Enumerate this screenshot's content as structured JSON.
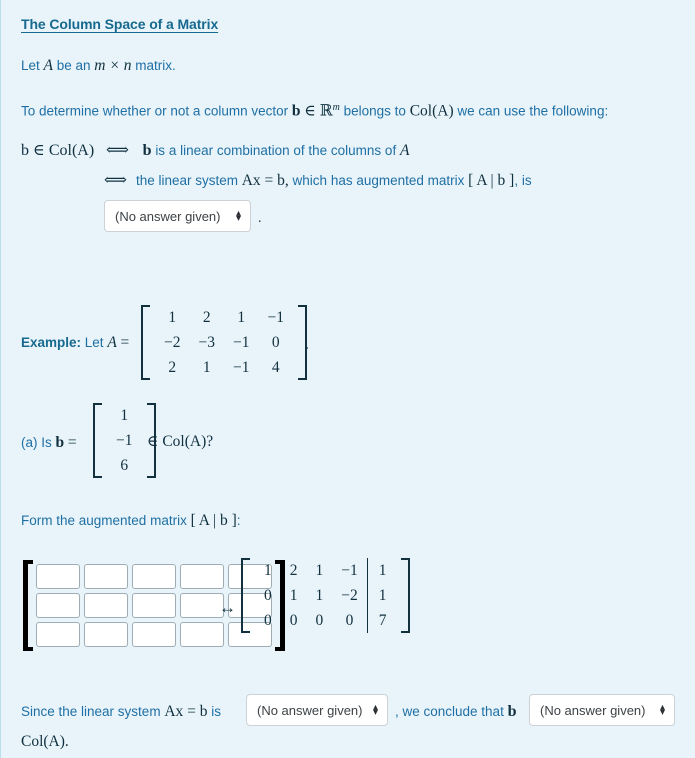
{
  "page": {
    "title": "The Column Space of a Matrix",
    "bg_color": "#e8f4fa",
    "text_color": "#1f6fa4",
    "math_color": "#12303e"
  },
  "intro": {
    "line1_pre": "Let ",
    "line1_A": "A",
    "line1_mid": " be an ",
    "line1_mn": "m × n",
    "line1_post": " matrix.",
    "line2_pre": "To determine whether or not a column vector ",
    "line2_b": "b",
    "line2_in": " ∈ ",
    "line2_rm": "ℝ",
    "line2_sup": "m",
    "line2_mid": " belongs to ",
    "line2_col": "Col(A)",
    "line2_post": " we can use the following:"
  },
  "criterion": {
    "row1_math": "b ∈ Col(A)",
    "row1_iff": "⟺",
    "row1_b": "b",
    "row1_text": "is a linear combination of the columns of ",
    "row1_A": "A",
    "row2_iff": "⟺",
    "row2_pre": "the linear system ",
    "row2_eq": "Ax = b,",
    "row2_mid": " which has augmented matrix ",
    "row2_aug": "[ A | b ]",
    "row2_post": ", is",
    "dropdown_value": "(No answer given)",
    "period": "."
  },
  "example": {
    "label": "Example:",
    "lead": " Let ",
    "A_symbol": "A",
    "equals": "=",
    "A_rows": [
      [
        "1",
        "2",
        "1",
        "−1"
      ],
      [
        "−2",
        "−3",
        "−1",
        "0"
      ],
      [
        "2",
        "1",
        "−1",
        "4"
      ]
    ],
    "trailing_period": ".",
    "part_a_pre": "(a) Is ",
    "part_a_b": "b",
    "part_a_eq": "=",
    "b_rows": [
      [
        "1"
      ],
      [
        "−1"
      ],
      [
        "6"
      ]
    ],
    "part_a_post": "∈ Col(A)?"
  },
  "form_aug": {
    "text_pre": "Form the augmented matrix ",
    "text_aug": "[ A | b ]",
    "text_post": ":",
    "grid": {
      "rows": 3,
      "cols": 5,
      "values": [
        [
          "",
          "",
          "",
          "",
          ""
        ],
        [
          "",
          "",
          "",
          "",
          ""
        ],
        [
          "",
          "",
          "",
          "",
          ""
        ]
      ],
      "placeholder": ""
    },
    "equiv_symbol": "↔",
    "rref_rows": [
      [
        "1",
        "2",
        "1",
        "−1",
        "1"
      ],
      [
        "0",
        "1",
        "1",
        "−2",
        "1"
      ],
      [
        "0",
        "0",
        "0",
        "0",
        "7"
      ]
    ]
  },
  "conclusion": {
    "pre": "Since the linear system ",
    "eq": "Ax = b",
    "is": " is",
    "dropdown1_value": "(No answer given)",
    "mid": ", we conclude that ",
    "b_symbol": "b",
    "dropdown2_value": "(No answer given)",
    "tail": "Col(A)."
  },
  "icons": {
    "chevron_up": "▴",
    "chevron_down": "▾"
  }
}
